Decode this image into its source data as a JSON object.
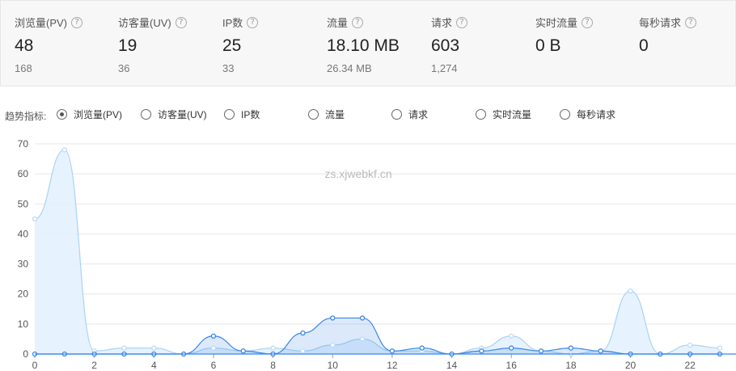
{
  "stats": [
    {
      "key": "pv",
      "label": "浏览量(PV)",
      "value": "48",
      "prev": "168"
    },
    {
      "key": "uv",
      "label": "访客量(UV)",
      "value": "19",
      "prev": "36"
    },
    {
      "key": "ip",
      "label": "IP数",
      "value": "25",
      "prev": "33"
    },
    {
      "key": "traffic",
      "label": "流量",
      "value": "18.10 MB",
      "prev": "26.34 MB"
    },
    {
      "key": "requests",
      "label": "请求",
      "value": "603",
      "prev": "1,274"
    },
    {
      "key": "realtime",
      "label": "实时流量",
      "value": "0 B",
      "prev": ""
    },
    {
      "key": "qps",
      "label": "每秒请求",
      "value": "0",
      "prev": ""
    }
  ],
  "help_icon_glyph": "?",
  "trend": {
    "label": "趋势指标:",
    "options": [
      "浏览量(PV)",
      "访客量(UV)",
      "IP数",
      "流量",
      "请求",
      "实时流量",
      "每秒请求"
    ],
    "selected": "浏览量(PV)"
  },
  "watermark": "zs.xjwebkf.cn",
  "colors": {
    "primary_line": "#3a86e8",
    "secondary_line": "#a9d3f5",
    "secondary_fill": "#e3f1fd",
    "grid": "#e8e8e8"
  },
  "chart_data": {
    "type": "area",
    "x": [
      0,
      1,
      2,
      3,
      4,
      5,
      6,
      7,
      8,
      9,
      10,
      11,
      12,
      13,
      14,
      15,
      16,
      17,
      18,
      19,
      20,
      21,
      22,
      23
    ],
    "ylim": [
      0,
      70
    ],
    "yticks": [
      0,
      10,
      20,
      30,
      40,
      50,
      60,
      70
    ],
    "xticks": [
      0,
      2,
      4,
      6,
      8,
      10,
      12,
      14,
      16,
      18,
      20,
      22
    ],
    "grid": true,
    "series": [
      {
        "values": [
          45,
          68,
          1,
          2,
          2,
          0,
          2,
          1,
          2,
          1,
          3,
          5,
          1,
          1,
          0,
          2,
          6,
          1,
          0,
          1,
          21,
          0,
          3,
          2
        ]
      },
      {
        "values": [
          0,
          0,
          0,
          0,
          0,
          0,
          6,
          1,
          0,
          7,
          12,
          12,
          1,
          2,
          0,
          1,
          2,
          1,
          2,
          1,
          0,
          0,
          0,
          0
        ]
      }
    ]
  }
}
